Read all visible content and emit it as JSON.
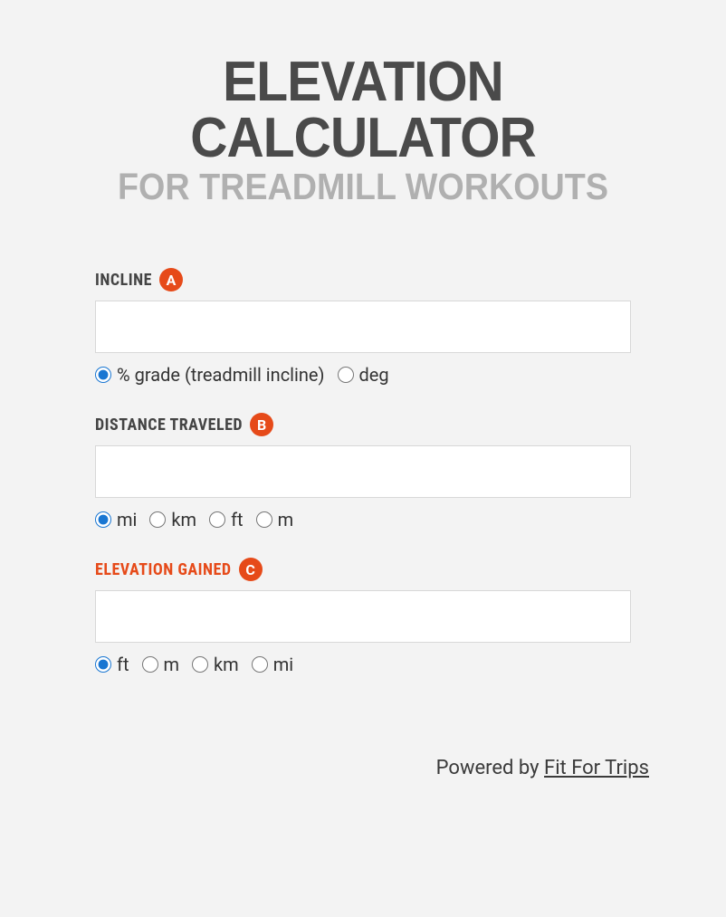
{
  "header": {
    "title_main": "ELEVATION CALCULATOR",
    "title_sub": "FOR TREADMILL WORKOUTS"
  },
  "incline": {
    "label": "INCLINE",
    "badge": "A",
    "value": "",
    "options": [
      {
        "label": "% grade (treadmill incline)",
        "checked": true
      },
      {
        "label": "deg",
        "checked": false
      }
    ]
  },
  "distance": {
    "label": "DISTANCE TRAVELED",
    "badge": "B",
    "value": "",
    "options": [
      {
        "label": "mi",
        "checked": true
      },
      {
        "label": "km",
        "checked": false
      },
      {
        "label": "ft",
        "checked": false
      },
      {
        "label": "m",
        "checked": false
      }
    ]
  },
  "elevation": {
    "label": "ELEVATION GAINED",
    "badge": "C",
    "value": "",
    "options": [
      {
        "label": "ft",
        "checked": true
      },
      {
        "label": "m",
        "checked": false
      },
      {
        "label": "km",
        "checked": false
      },
      {
        "label": "mi",
        "checked": false
      }
    ]
  },
  "footer": {
    "prefix": "Powered by ",
    "link_text": "Fit For Trips"
  }
}
